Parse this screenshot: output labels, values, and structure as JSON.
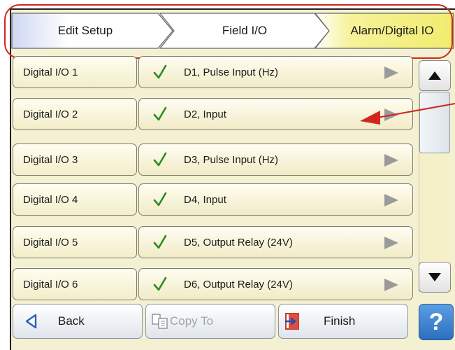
{
  "breadcrumb": {
    "items": [
      {
        "label": "Edit Setup"
      },
      {
        "label": "Field I/O"
      },
      {
        "label": "Alarm/Digital IO"
      }
    ]
  },
  "rows": [
    {
      "label": "Digital I/O 1",
      "value": "D1, Pulse Input  (Hz)"
    },
    {
      "label": "Digital I/O 2",
      "value": "D2, Input"
    },
    {
      "label": "Digital I/O 3",
      "value": "D3, Pulse Input  (Hz)"
    },
    {
      "label": "Digital I/O 4",
      "value": "D4, Input"
    },
    {
      "label": "Digital I/O 5",
      "value": "D5, Output Relay (24V)"
    },
    {
      "label": "Digital I/O 6",
      "value": "D6, Output Relay (24V)"
    }
  ],
  "buttons": {
    "back": "Back",
    "copy_to": "Copy To",
    "finish": "Finish",
    "help": "?"
  },
  "colors": {
    "annotation": "#d0261d",
    "check": "#2e8b1e",
    "active_crumb": "#f4ef7a"
  },
  "icons": {
    "row_status": "check-icon",
    "row_expand": "triangle-right-icon",
    "scroll_up": "triangle-up-icon",
    "scroll_down": "triangle-down-icon",
    "back": "triangle-left-icon",
    "copy": "copy-icon",
    "finish": "finish-icon"
  }
}
